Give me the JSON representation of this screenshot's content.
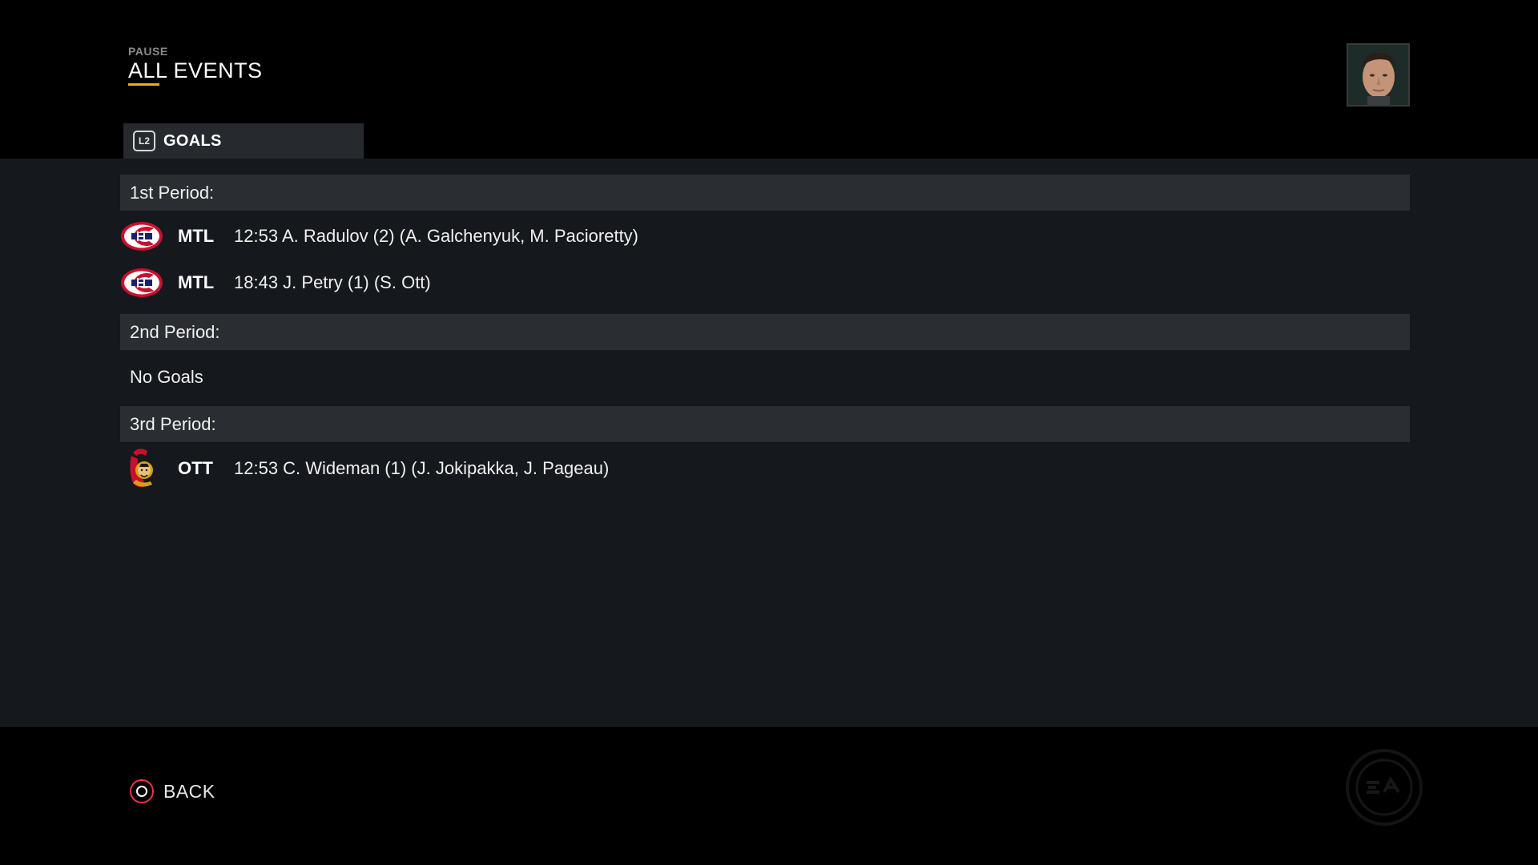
{
  "header": {
    "subtitle": "PAUSE",
    "title": "ALL EVENTS",
    "accent_color": "#f5a623"
  },
  "tab": {
    "button_hint": "L2",
    "label": "GOALS"
  },
  "periods": [
    {
      "label": "1st Period:",
      "goals": [
        {
          "team": "MTL",
          "logo": "canadiens-logo",
          "text": "12:53 A. Radulov (2) (A. Galchenyuk, M. Pacioretty)"
        },
        {
          "team": "MTL",
          "logo": "canadiens-logo",
          "text": "18:43 J. Petry (1) (S. Ott)"
        }
      ]
    },
    {
      "label": "2nd Period:",
      "empty_text": "No Goals"
    },
    {
      "label": "3rd Period:",
      "goals": [
        {
          "team": "OTT",
          "logo": "senators-logo",
          "text": "12:53 C. Wideman (1) (J. Jokipakka, J. Pageau)"
        }
      ]
    }
  ],
  "footer": {
    "back_label": "BACK",
    "back_icon": "circle-button-icon",
    "brand_icon": "ea-sports-logo"
  }
}
